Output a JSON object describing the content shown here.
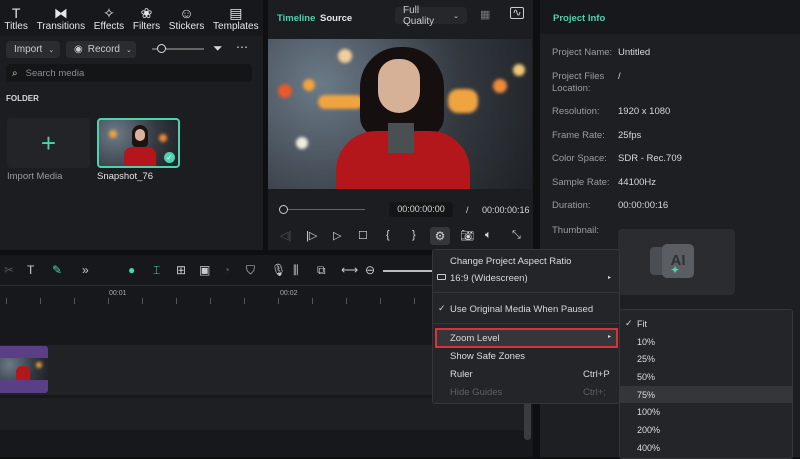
{
  "toolbar": {
    "items": [
      {
        "label": "Titles",
        "icon": "T"
      },
      {
        "label": "Transitions",
        "icon": "⧓"
      },
      {
        "label": "Effects",
        "icon": "✧"
      },
      {
        "label": "Filters",
        "icon": "❀"
      },
      {
        "label": "Stickers",
        "icon": "☺"
      },
      {
        "label": "Templates",
        "icon": "▤"
      }
    ]
  },
  "media": {
    "import_label": "Import",
    "record_label": "Record",
    "search_placeholder": "Search media",
    "folder_label": "FOLDER",
    "import_media_label": "Import Media",
    "clip_name": "Snapshot_76"
  },
  "preview": {
    "tab_timeline": "Timeline",
    "tab_source": "Source",
    "quality": "Full Quality",
    "current_time": "00:00:00:00",
    "separator": "/",
    "total_time": "00:00:00:16"
  },
  "project_info": {
    "title": "Project Info",
    "rows": [
      {
        "label": "Project Name:",
        "value": "Untitled"
      },
      {
        "label": "Project Files Location:",
        "value": "/"
      },
      {
        "label": "Resolution:",
        "value": "1920 x 1080"
      },
      {
        "label": "Frame Rate:",
        "value": "25fps"
      },
      {
        "label": "Color Space:",
        "value": "SDR - Rec.709"
      },
      {
        "label": "Sample Rate:",
        "value": "44100Hz"
      },
      {
        "label": "Duration:",
        "value": "00:00:00:16"
      }
    ],
    "thumbnail_label": "Thumbnail:",
    "thumbnail_badge": "AI"
  },
  "timeline": {
    "ruler": [
      "00:01",
      "00:02"
    ]
  },
  "context_menu": {
    "change_aspect": "Change Project Aspect Ratio",
    "aspect_value": "16:9 (Widescreen)",
    "use_original": "Use Original Media When Paused",
    "zoom_level": "Zoom Level",
    "safe_zones": "Show Safe Zones",
    "ruler": "Ruler",
    "ruler_shortcut": "Ctrl+P",
    "hide_guides": "Hide Guides",
    "hide_guides_shortcut": "Ctrl+;"
  },
  "zoom_submenu": {
    "selected": "Fit",
    "options": [
      "Fit",
      "10%",
      "25%",
      "50%",
      "75%",
      "100%",
      "200%",
      "400%"
    ],
    "highlighted": "75%"
  },
  "colors": {
    "accent": "#4fd1b0",
    "highlight_border": "#d9323a"
  }
}
